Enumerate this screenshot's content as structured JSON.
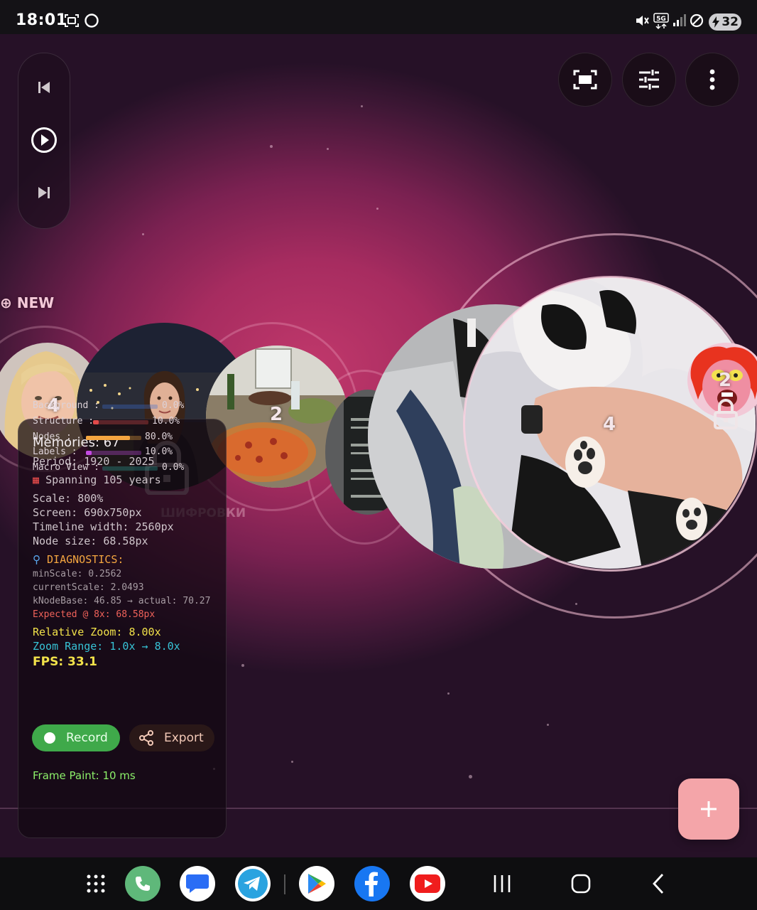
{
  "status_bar": {
    "time": "18:01",
    "battery": "32",
    "left_icons": [
      "screenshot-icon",
      "circle-app-icon"
    ],
    "right_icons": [
      "mute-vibrate-icon",
      "5g-data-icon",
      "signal-icon",
      "do-not-disturb-icon"
    ]
  },
  "timeline": {
    "new_label": "NEW",
    "encrypt_label": "ШИФРОВКИ",
    "bubbles": [
      {
        "count": "4",
        "photo": "blonde woman portrait"
      },
      {
        "count": "",
        "photo": "woman at night with city lights"
      },
      {
        "count": "2",
        "photo": "table with pizza and food"
      },
      {
        "count": "",
        "photo": "phone screen"
      },
      {
        "count": "",
        "photo": "cat on blanket"
      },
      {
        "count": "4",
        "photo": "black and white cat paws"
      },
      {
        "count": "2",
        "photo": "red-haired cartoon character"
      }
    ]
  },
  "stats": {
    "memories": "Memories: 67",
    "period": "Period: 1920 - 2025",
    "spanning": "Spanning 105 years",
    "scale": "Scale: 800%",
    "screen": "Screen: 690x750px",
    "timeline_width": "Timeline width: 2560px",
    "node_size": "Node size: 68.58px",
    "diagnostics_title": "DIAGNOSTICS:",
    "min_scale": "minScale: 0.2562",
    "current_scale": "currentScale: 2.0493",
    "knode": "kNodeBase: 46.85 → actual: 70.27",
    "expected": "Expected @ 8x: 68.58px",
    "relative_zoom": "Relative Zoom: 8.00x",
    "zoom_range": "Zoom Range: 1.0x → 8.0x",
    "fps": "FPS: 33.1",
    "record_label": "Record",
    "export_label": "Export",
    "frame_paint": "Frame Paint: 10 ms",
    "perf": [
      {
        "label": "Background :",
        "value": "0.0%",
        "fraction": 0.0,
        "color": "#3d6fd6"
      },
      {
        "label": "Structure  :",
        "value": "10.0%",
        "fraction": 0.1,
        "color": "#e24a4a"
      },
      {
        "label": "Nodes      :",
        "value": "80.0%",
        "fraction": 0.8,
        "color": "#f4a640"
      },
      {
        "label": "Labels     :",
        "value": "10.0%",
        "fraction": 0.1,
        "color": "#c44ae2"
      },
      {
        "label": "Macro View :",
        "value": "0.0%",
        "fraction": 0.0,
        "color": "#2aa39a"
      }
    ]
  },
  "colors": {
    "accent_pink": "#c0386b",
    "fab": "#f4a5a9",
    "record_green": "#3fa94a",
    "diagnostics_orange": "#f4a640",
    "expected_red": "#f0625a",
    "zoom_yellow": "#f2e24a",
    "range_cyan": "#37c3d6",
    "frame_green": "#8cf06a"
  },
  "dock_apps": [
    "app-drawer-icon",
    "phone-icon",
    "messages-icon",
    "telegram-icon",
    "play-store-icon",
    "facebook-icon",
    "youtube-icon"
  ],
  "nav_keys": [
    "recents-icon",
    "home-icon",
    "back-icon"
  ]
}
